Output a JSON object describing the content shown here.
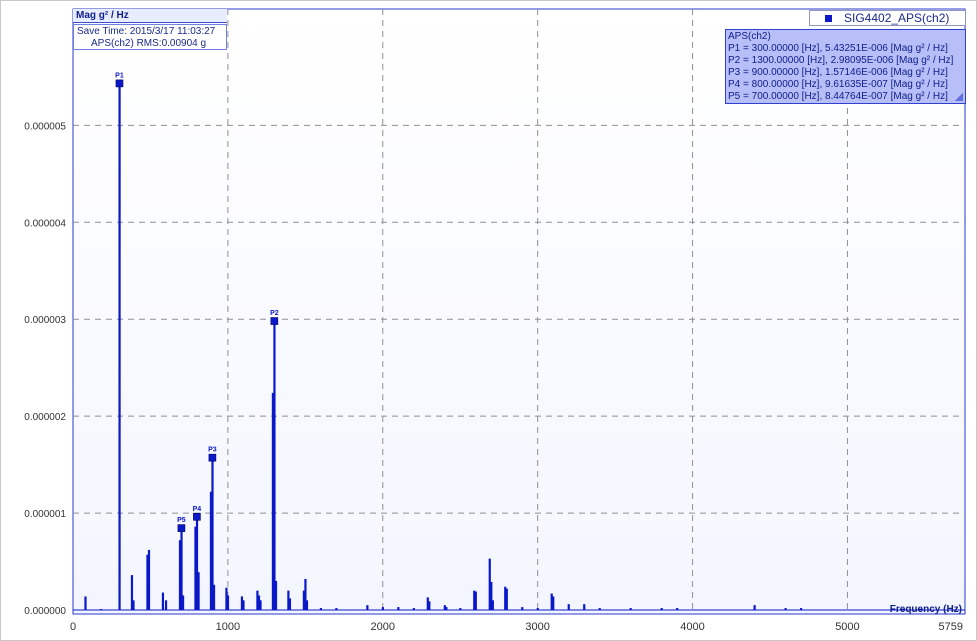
{
  "chart_data": {
    "type": "bar",
    "ylabel": "Mag g² / Hz",
    "xlabel": "Frequency (Hz)",
    "xlim": [
      0,
      5759
    ],
    "ylim": [
      0,
      6.2e-06
    ],
    "x_ticks": [
      0,
      1000,
      2000,
      3000,
      4000,
      5000,
      5759
    ],
    "y_ticks": [
      0,
      1e-06,
      2e-06,
      3e-06,
      4e-06,
      5e-06
    ],
    "y_tick_labels": [
      "0.000000",
      "0.000001",
      "0.000002",
      "0.000003",
      "0.000004",
      "0.000005"
    ],
    "grid": true,
    "legend_position": "top-right",
    "series": [
      {
        "name": "SIG4402_APS(ch2)",
        "color": "#0a18c8",
        "x": [
          80,
          180,
          300,
          380,
          390,
          480,
          490,
          580,
          600,
          690,
          700,
          710,
          790,
          800,
          810,
          890,
          900,
          910,
          990,
          1000,
          1090,
          1100,
          1190,
          1200,
          1210,
          1290,
          1300,
          1310,
          1390,
          1400,
          1490,
          1500,
          1510,
          1600,
          1700,
          1900,
          2000,
          2100,
          2200,
          2290,
          2300,
          2400,
          2410,
          2500,
          2590,
          2600,
          2690,
          2700,
          2710,
          2790,
          2800,
          2900,
          3000,
          3090,
          3100,
          3200,
          3300,
          3400,
          3600,
          3800,
          3900,
          4400,
          4600,
          4700
        ],
        "values": [
          1.4e-07,
          1e-08,
          5.43251e-06,
          3.6e-07,
          1e-07,
          5.7e-07,
          6.2e-07,
          1.8e-07,
          1e-07,
          7.2e-07,
          8.44764e-07,
          1.5e-07,
          8.6e-07,
          9.61635e-07,
          3.9e-07,
          1.22e-06,
          1.57146e-06,
          2.6e-07,
          2.3e-07,
          1.5e-07,
          1.4e-07,
          1e-07,
          2e-07,
          1.5e-07,
          1e-07,
          2.24e-06,
          2.98095e-06,
          3e-07,
          2e-07,
          1.2e-07,
          2e-07,
          3.2e-07,
          1e-07,
          2e-08,
          2e-08,
          5e-08,
          3e-08,
          3e-08,
          2e-08,
          1.3e-07,
          9e-08,
          5e-08,
          3e-08,
          2e-08,
          2e-07,
          1.9e-07,
          5.3e-07,
          2.9e-07,
          1e-07,
          2.4e-07,
          2.2e-07,
          3e-08,
          2e-08,
          1.7e-07,
          1.4e-07,
          6e-08,
          6e-08,
          2e-08,
          2e-08,
          2e-08,
          2e-08,
          5e-08,
          2e-08,
          2e-08
        ]
      }
    ],
    "peaks": [
      {
        "label": "P1",
        "x": 300,
        "y": 5.43251e-06
      },
      {
        "label": "P2",
        "x": 1300,
        "y": 2.98095e-06
      },
      {
        "label": "P3",
        "x": 900,
        "y": 1.57146e-06
      },
      {
        "label": "P4",
        "x": 800,
        "y": 9.61635e-07
      },
      {
        "label": "P5",
        "x": 700,
        "y": 8.44764e-07
      }
    ]
  },
  "info": {
    "save_time": "Save Time: 2015/3/17 11:03:27",
    "rms": "APS(ch2) RMS:0.00904 g"
  },
  "peak_panel": {
    "title": "APS(ch2)",
    "lines": [
      "P1 = 300.00000 [Hz], 5.43251E-006 [Mag g² / Hz]",
      "P2 = 1300.00000 [Hz], 2.98095E-006 [Mag g² / Hz]",
      "P3 = 900.00000 [Hz], 1.57146E-006 [Mag g² / Hz]",
      "P4 = 800.00000 [Hz], 9.61635E-007 [Mag g² / Hz]",
      "P5 = 700.00000 [Hz], 8.44764E-007 [Mag g² / Hz]"
    ]
  },
  "legend_label": "SIG4402_APS(ch2)"
}
